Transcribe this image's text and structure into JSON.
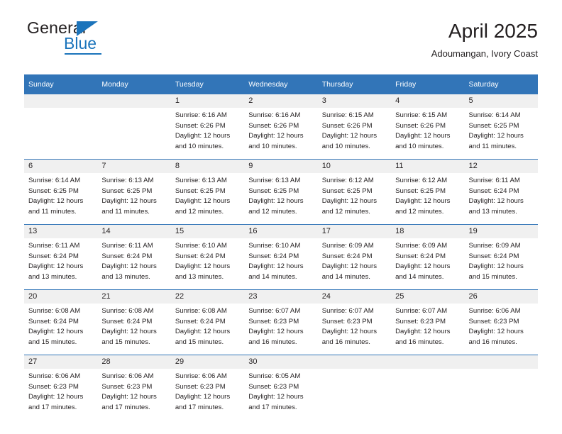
{
  "logo": {
    "word_top": "General",
    "word_bottom": "Blue",
    "accent_color": "#1b74bb"
  },
  "header": {
    "title": "April 2025",
    "subtitle": "Adoumangan, Ivory Coast"
  },
  "theme": {
    "header_blue": "#3275b8",
    "daynum_gray": "#f0f0f0",
    "text": "#231f20"
  },
  "calendar": {
    "weekday_headers": [
      "Sunday",
      "Monday",
      "Tuesday",
      "Wednesday",
      "Thursday",
      "Friday",
      "Saturday"
    ],
    "weeks": [
      [
        {
          "day": "",
          "sunrise": "",
          "sunset": "",
          "daylight_1": "",
          "daylight_2": ""
        },
        {
          "day": "",
          "sunrise": "",
          "sunset": "",
          "daylight_1": "",
          "daylight_2": ""
        },
        {
          "day": "1",
          "sunrise": "Sunrise: 6:16 AM",
          "sunset": "Sunset: 6:26 PM",
          "daylight_1": "Daylight: 12 hours",
          "daylight_2": "and 10 minutes."
        },
        {
          "day": "2",
          "sunrise": "Sunrise: 6:16 AM",
          "sunset": "Sunset: 6:26 PM",
          "daylight_1": "Daylight: 12 hours",
          "daylight_2": "and 10 minutes."
        },
        {
          "day": "3",
          "sunrise": "Sunrise: 6:15 AM",
          "sunset": "Sunset: 6:26 PM",
          "daylight_1": "Daylight: 12 hours",
          "daylight_2": "and 10 minutes."
        },
        {
          "day": "4",
          "sunrise": "Sunrise: 6:15 AM",
          "sunset": "Sunset: 6:26 PM",
          "daylight_1": "Daylight: 12 hours",
          "daylight_2": "and 10 minutes."
        },
        {
          "day": "5",
          "sunrise": "Sunrise: 6:14 AM",
          "sunset": "Sunset: 6:25 PM",
          "daylight_1": "Daylight: 12 hours",
          "daylight_2": "and 11 minutes."
        }
      ],
      [
        {
          "day": "6",
          "sunrise": "Sunrise: 6:14 AM",
          "sunset": "Sunset: 6:25 PM",
          "daylight_1": "Daylight: 12 hours",
          "daylight_2": "and 11 minutes."
        },
        {
          "day": "7",
          "sunrise": "Sunrise: 6:13 AM",
          "sunset": "Sunset: 6:25 PM",
          "daylight_1": "Daylight: 12 hours",
          "daylight_2": "and 11 minutes."
        },
        {
          "day": "8",
          "sunrise": "Sunrise: 6:13 AM",
          "sunset": "Sunset: 6:25 PM",
          "daylight_1": "Daylight: 12 hours",
          "daylight_2": "and 12 minutes."
        },
        {
          "day": "9",
          "sunrise": "Sunrise: 6:13 AM",
          "sunset": "Sunset: 6:25 PM",
          "daylight_1": "Daylight: 12 hours",
          "daylight_2": "and 12 minutes."
        },
        {
          "day": "10",
          "sunrise": "Sunrise: 6:12 AM",
          "sunset": "Sunset: 6:25 PM",
          "daylight_1": "Daylight: 12 hours",
          "daylight_2": "and 12 minutes."
        },
        {
          "day": "11",
          "sunrise": "Sunrise: 6:12 AM",
          "sunset": "Sunset: 6:25 PM",
          "daylight_1": "Daylight: 12 hours",
          "daylight_2": "and 12 minutes."
        },
        {
          "day": "12",
          "sunrise": "Sunrise: 6:11 AM",
          "sunset": "Sunset: 6:24 PM",
          "daylight_1": "Daylight: 12 hours",
          "daylight_2": "and 13 minutes."
        }
      ],
      [
        {
          "day": "13",
          "sunrise": "Sunrise: 6:11 AM",
          "sunset": "Sunset: 6:24 PM",
          "daylight_1": "Daylight: 12 hours",
          "daylight_2": "and 13 minutes."
        },
        {
          "day": "14",
          "sunrise": "Sunrise: 6:11 AM",
          "sunset": "Sunset: 6:24 PM",
          "daylight_1": "Daylight: 12 hours",
          "daylight_2": "and 13 minutes."
        },
        {
          "day": "15",
          "sunrise": "Sunrise: 6:10 AM",
          "sunset": "Sunset: 6:24 PM",
          "daylight_1": "Daylight: 12 hours",
          "daylight_2": "and 13 minutes."
        },
        {
          "day": "16",
          "sunrise": "Sunrise: 6:10 AM",
          "sunset": "Sunset: 6:24 PM",
          "daylight_1": "Daylight: 12 hours",
          "daylight_2": "and 14 minutes."
        },
        {
          "day": "17",
          "sunrise": "Sunrise: 6:09 AM",
          "sunset": "Sunset: 6:24 PM",
          "daylight_1": "Daylight: 12 hours",
          "daylight_2": "and 14 minutes."
        },
        {
          "day": "18",
          "sunrise": "Sunrise: 6:09 AM",
          "sunset": "Sunset: 6:24 PM",
          "daylight_1": "Daylight: 12 hours",
          "daylight_2": "and 14 minutes."
        },
        {
          "day": "19",
          "sunrise": "Sunrise: 6:09 AM",
          "sunset": "Sunset: 6:24 PM",
          "daylight_1": "Daylight: 12 hours",
          "daylight_2": "and 15 minutes."
        }
      ],
      [
        {
          "day": "20",
          "sunrise": "Sunrise: 6:08 AM",
          "sunset": "Sunset: 6:24 PM",
          "daylight_1": "Daylight: 12 hours",
          "daylight_2": "and 15 minutes."
        },
        {
          "day": "21",
          "sunrise": "Sunrise: 6:08 AM",
          "sunset": "Sunset: 6:24 PM",
          "daylight_1": "Daylight: 12 hours",
          "daylight_2": "and 15 minutes."
        },
        {
          "day": "22",
          "sunrise": "Sunrise: 6:08 AM",
          "sunset": "Sunset: 6:24 PM",
          "daylight_1": "Daylight: 12 hours",
          "daylight_2": "and 15 minutes."
        },
        {
          "day": "23",
          "sunrise": "Sunrise: 6:07 AM",
          "sunset": "Sunset: 6:23 PM",
          "daylight_1": "Daylight: 12 hours",
          "daylight_2": "and 16 minutes."
        },
        {
          "day": "24",
          "sunrise": "Sunrise: 6:07 AM",
          "sunset": "Sunset: 6:23 PM",
          "daylight_1": "Daylight: 12 hours",
          "daylight_2": "and 16 minutes."
        },
        {
          "day": "25",
          "sunrise": "Sunrise: 6:07 AM",
          "sunset": "Sunset: 6:23 PM",
          "daylight_1": "Daylight: 12 hours",
          "daylight_2": "and 16 minutes."
        },
        {
          "day": "26",
          "sunrise": "Sunrise: 6:06 AM",
          "sunset": "Sunset: 6:23 PM",
          "daylight_1": "Daylight: 12 hours",
          "daylight_2": "and 16 minutes."
        }
      ],
      [
        {
          "day": "27",
          "sunrise": "Sunrise: 6:06 AM",
          "sunset": "Sunset: 6:23 PM",
          "daylight_1": "Daylight: 12 hours",
          "daylight_2": "and 17 minutes."
        },
        {
          "day": "28",
          "sunrise": "Sunrise: 6:06 AM",
          "sunset": "Sunset: 6:23 PM",
          "daylight_1": "Daylight: 12 hours",
          "daylight_2": "and 17 minutes."
        },
        {
          "day": "29",
          "sunrise": "Sunrise: 6:06 AM",
          "sunset": "Sunset: 6:23 PM",
          "daylight_1": "Daylight: 12 hours",
          "daylight_2": "and 17 minutes."
        },
        {
          "day": "30",
          "sunrise": "Sunrise: 6:05 AM",
          "sunset": "Sunset: 6:23 PM",
          "daylight_1": "Daylight: 12 hours",
          "daylight_2": "and 17 minutes."
        },
        {
          "day": "",
          "sunrise": "",
          "sunset": "",
          "daylight_1": "",
          "daylight_2": ""
        },
        {
          "day": "",
          "sunrise": "",
          "sunset": "",
          "daylight_1": "",
          "daylight_2": ""
        },
        {
          "day": "",
          "sunrise": "",
          "sunset": "",
          "daylight_1": "",
          "daylight_2": ""
        }
      ]
    ]
  }
}
